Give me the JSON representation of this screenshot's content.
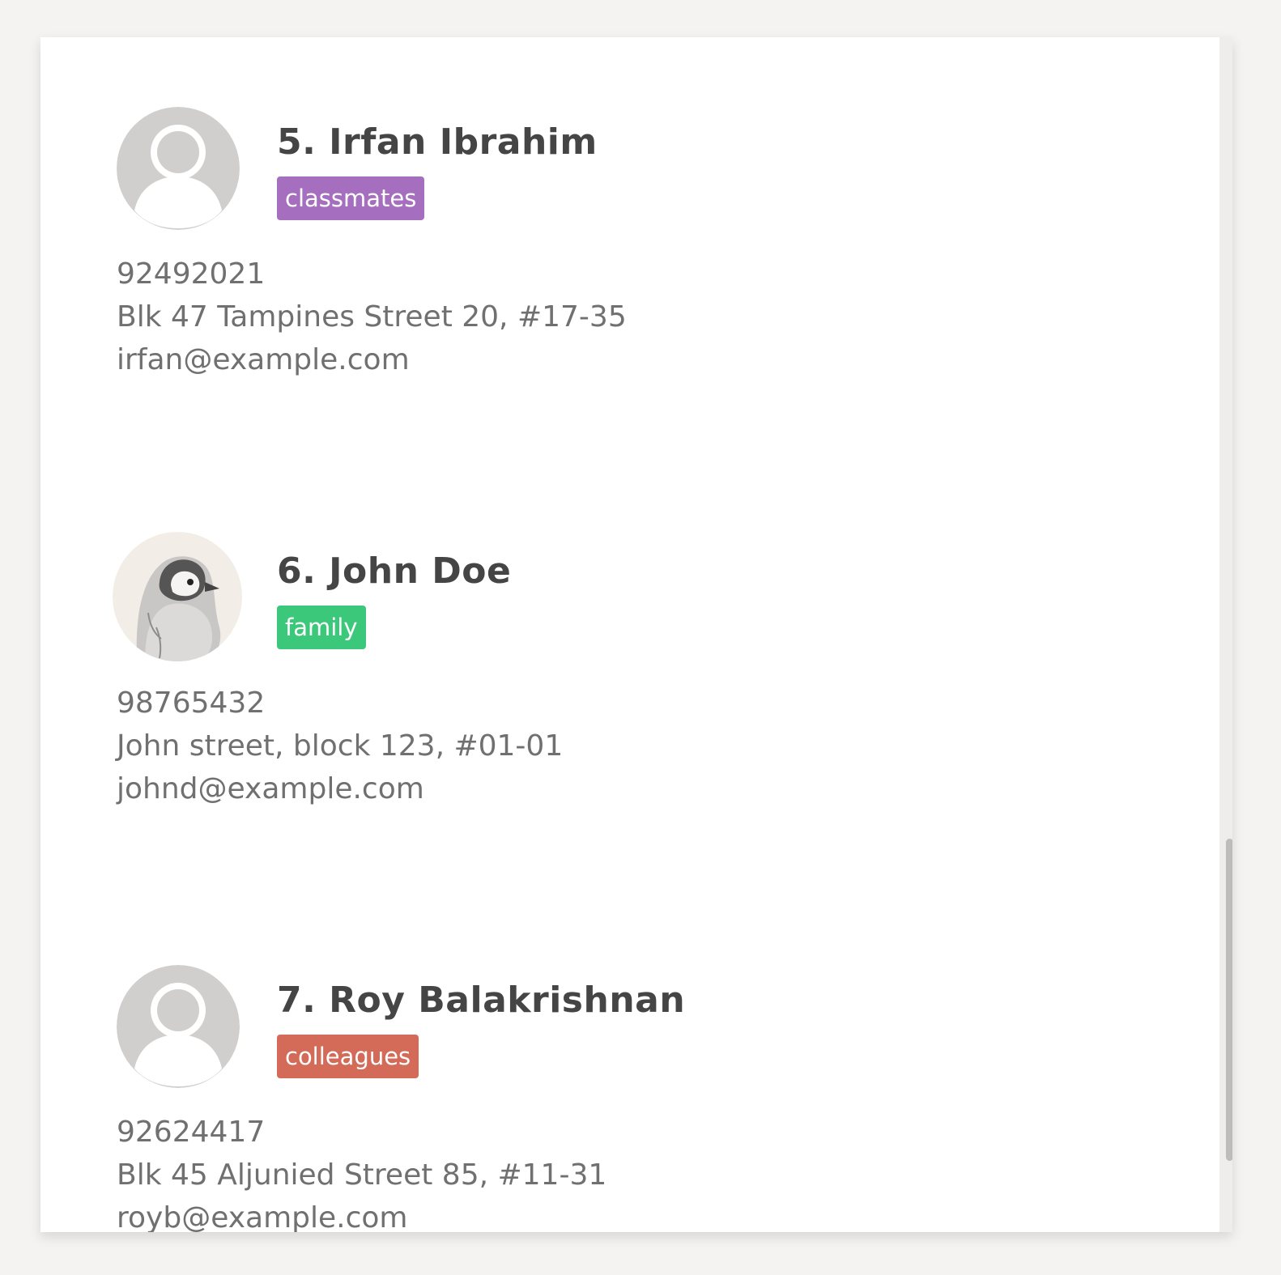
{
  "contacts": [
    {
      "index_name": "5. Irfan Ibrahim",
      "tag": "classmates",
      "tag_color": "#a66ebf",
      "phone": "92492021",
      "address": "Blk 47 Tampines Street 20, #17-35",
      "email": "irfan@example.com",
      "avatar": "default-user-icon"
    },
    {
      "index_name": "6. John Doe",
      "tag": "family",
      "tag_color": "#3cc87a",
      "phone": "98765432",
      "address": "John street, block 123, #01-01",
      "email": "johnd@example.com",
      "avatar": "penguin-avatar"
    },
    {
      "index_name": "7. Roy Balakrishnan",
      "tag": "colleagues",
      "tag_color": "#d46a58",
      "phone": "92624417",
      "address": "Blk 45 Aljunied Street 85, #11-31",
      "email": "royb@example.com",
      "avatar": "default-user-icon"
    }
  ]
}
